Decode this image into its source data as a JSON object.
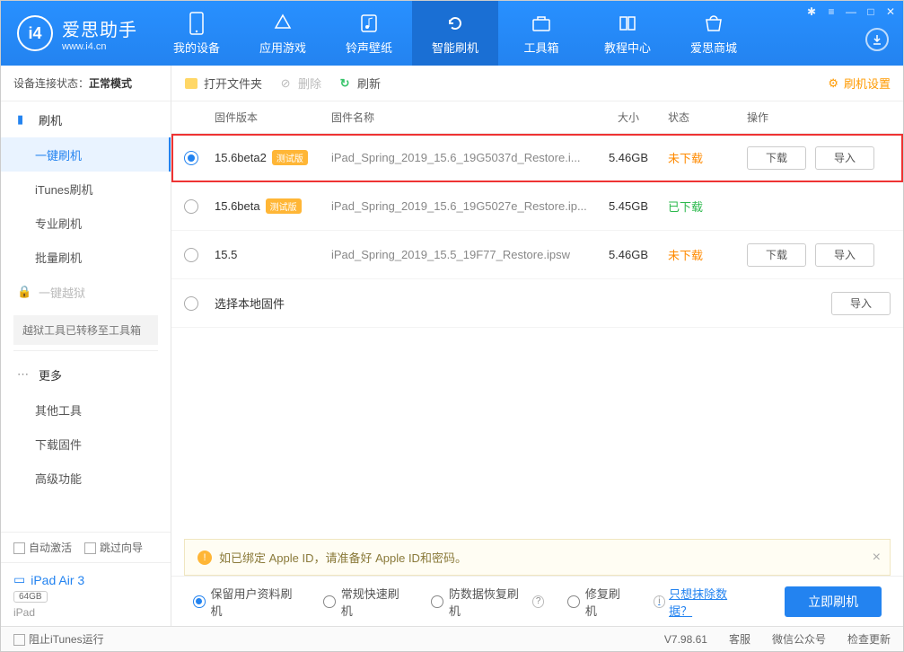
{
  "app": {
    "name": "爱思助手",
    "url": "www.i4.cn"
  },
  "topTabs": [
    {
      "label": "我的设备"
    },
    {
      "label": "应用游戏"
    },
    {
      "label": "铃声壁纸"
    },
    {
      "label": "智能刷机"
    },
    {
      "label": "工具箱"
    },
    {
      "label": "教程中心"
    },
    {
      "label": "爱思商城"
    }
  ],
  "connStatus": {
    "prefix": "设备连接状态：",
    "mode": "正常模式"
  },
  "sidebar": {
    "flash": "刷机",
    "items": [
      "一键刷机",
      "iTunes刷机",
      "专业刷机",
      "批量刷机"
    ],
    "jailbreak": "一键越狱",
    "jailbreakNote": "越狱工具已转移至工具箱",
    "more": "更多",
    "moreItems": [
      "其他工具",
      "下载固件",
      "高级功能"
    ]
  },
  "optRow": {
    "autoActivate": "自动激活",
    "skipGuide": "跳过向导"
  },
  "device": {
    "name": "iPad Air 3",
    "storage": "64GB",
    "type": "iPad"
  },
  "toolbar": {
    "openFolder": "打开文件夹",
    "delete": "删除",
    "refresh": "刷新",
    "settings": "刷机设置"
  },
  "tableHead": {
    "version": "固件版本",
    "name": "固件名称",
    "size": "大小",
    "status": "状态",
    "action": "操作"
  },
  "rows": [
    {
      "version": "15.6beta2",
      "beta": "测试版",
      "name": "iPad_Spring_2019_15.6_19G5037d_Restore.i...",
      "size": "5.46GB",
      "status": "未下载",
      "statusClass": "orange",
      "selected": true,
      "showBtns": true
    },
    {
      "version": "15.6beta",
      "beta": "测试版",
      "name": "iPad_Spring_2019_15.6_19G5027e_Restore.ip...",
      "size": "5.45GB",
      "status": "已下载",
      "statusClass": "green",
      "selected": false,
      "showBtns": false
    },
    {
      "version": "15.5",
      "beta": "",
      "name": "iPad_Spring_2019_15.5_19F77_Restore.ipsw",
      "size": "5.46GB",
      "status": "未下载",
      "statusClass": "orange",
      "selected": false,
      "showBtns": true
    }
  ],
  "localRow": {
    "label": "选择本地固件",
    "importBtn": "导入"
  },
  "buttons": {
    "download": "下载",
    "import": "导入"
  },
  "notice": "如已绑定 Apple ID，请准备好 Apple ID和密码。",
  "flashOpts": {
    "keepData": "保留用户资料刷机",
    "quick": "常规快速刷机",
    "recover": "防数据恢复刷机",
    "repair": "修复刷机",
    "eraseLink": "只想抹除数据？",
    "flashBtn": "立即刷机"
  },
  "statusbar": {
    "blockItunes": "阻止iTunes运行",
    "version": "V7.98.61",
    "support": "客服",
    "wechat": "微信公众号",
    "update": "检查更新"
  }
}
